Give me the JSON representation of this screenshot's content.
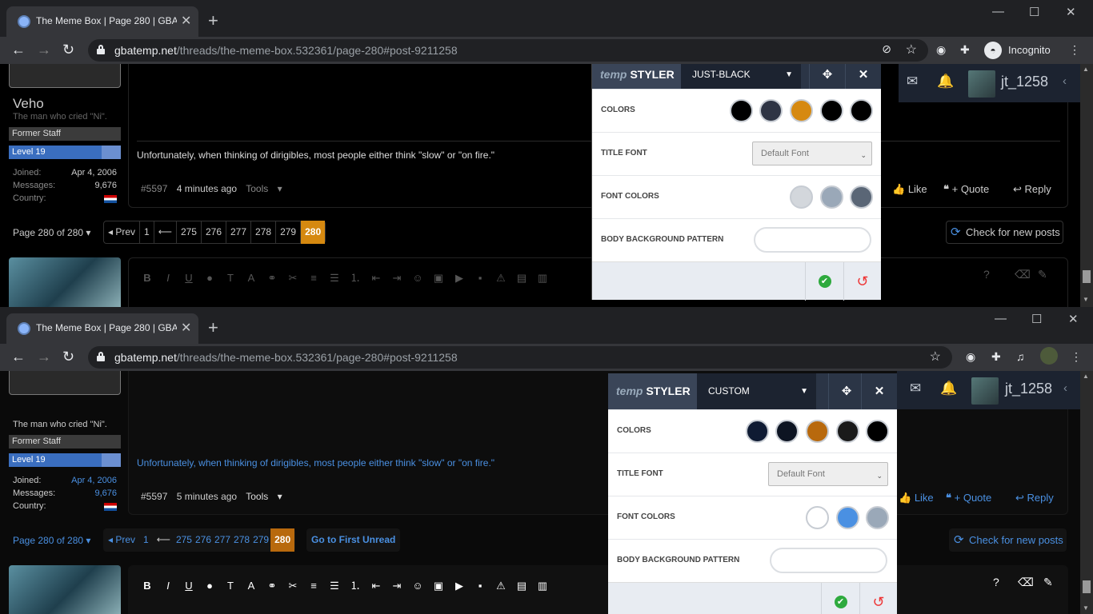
{
  "browser": {
    "tab_title": "The Meme Box | Page 280 | GBAtemp.net",
    "url_host": "gbatemp.net",
    "url_path": "/threads/the-meme-box.532361/page-280#post-9211258",
    "incognito_label": "Incognito"
  },
  "post": {
    "username": "Veho",
    "user_title": "The man who cried \"Ni\".",
    "badge_staff": "Former Staff",
    "badge_level": "Level 19",
    "joined_label": "Joined:",
    "joined_value": "Apr 4, 2006",
    "messages_label": "Messages:",
    "messages_value": "9,676",
    "country_label": "Country:",
    "message": "Unfortunately, when thinking of dirigibles, most people either think \"slow\" or \"on fire.\"",
    "post_number": "#5597",
    "time_top": "4 minutes ago",
    "time_bottom": "5 minutes ago",
    "tools": "Tools",
    "like": "Like",
    "quote": "+ Quote",
    "reply": "Reply"
  },
  "pagination": {
    "label": "Page 280 of 280",
    "prev": "Prev",
    "pages_top": [
      "1",
      "⟵",
      "275",
      "276",
      "277",
      "278",
      "279",
      "280"
    ],
    "pages_bottom": [
      "1",
      "⟵",
      "275",
      "276",
      "277",
      "278",
      "279",
      "280"
    ],
    "go_first_unread": "Go to First Unread",
    "check_new": "Check for new posts"
  },
  "userbar": {
    "username": "jt_1258"
  },
  "styler_top": {
    "logo_prefix": "temp",
    "logo_main": "STYLER",
    "theme": "JUST-BLACK",
    "colors_label": "COLORS",
    "colors": [
      "#000000",
      "#2e3444",
      "#d68910",
      "#000000",
      "#000000"
    ],
    "title_font_label": "TITLE FONT",
    "title_font_value": "Default Font",
    "font_colors_label": "FONT COLORS",
    "font_colors": [
      "#d3d7dc",
      "#9aa8b8",
      "#5a6676"
    ],
    "pattern_label": "BODY BACKGROUND PATTERN"
  },
  "styler_bottom": {
    "logo_prefix": "temp",
    "logo_main": "STYLER",
    "theme": "CUSTOM",
    "colors_label": "COLORS",
    "colors": [
      "#0f1b33",
      "#0d1422",
      "#b8690d",
      "#1a1a1a",
      "#000000"
    ],
    "title_font_label": "TITLE FONT",
    "title_font_value": "Default Font",
    "font_colors_label": "FONT COLORS",
    "font_colors": [
      "#ffffff",
      "#4a90e2",
      "#9aa8b8"
    ],
    "pattern_label": "BODY BACKGROUND PATTERN"
  },
  "colors": {
    "accent_orange": "#d68910",
    "link_blue": "#4a90e2"
  }
}
